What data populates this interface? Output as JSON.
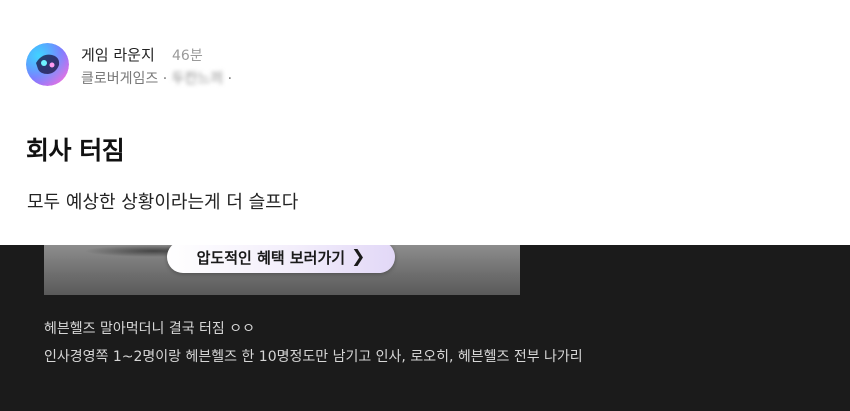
{
  "post": {
    "channel": "게임 라운지",
    "time_ago": "46분",
    "author_prefix": "클로버게임즈 · ",
    "author_blurred": "두칸느끼",
    "author_suffix": " ·",
    "title": "회사 터짐",
    "body": "모두 예상한 상황이라는게 더 슬프다"
  },
  "embed": {
    "banner_button_label": "압도적인 혜택 보러가기",
    "banner_chevron_icon": "chevron-right-icon",
    "line1": "헤븐헬즈 말아먹더니 결국 터짐 ㅇㅇ",
    "line2": "인사경영쪽 1~2명이랑 헤븐헬즈 한 10명정도만 남기고 인사, 로오히, 헤븐헬즈 전부 나가리"
  },
  "colors": {
    "dark_background": "#1b1b1b",
    "avatar_gradient_start": "#7b5cff",
    "avatar_gradient_end": "#ff7ad9"
  },
  "icons": {
    "avatar": "game-lounge-logo-icon"
  }
}
